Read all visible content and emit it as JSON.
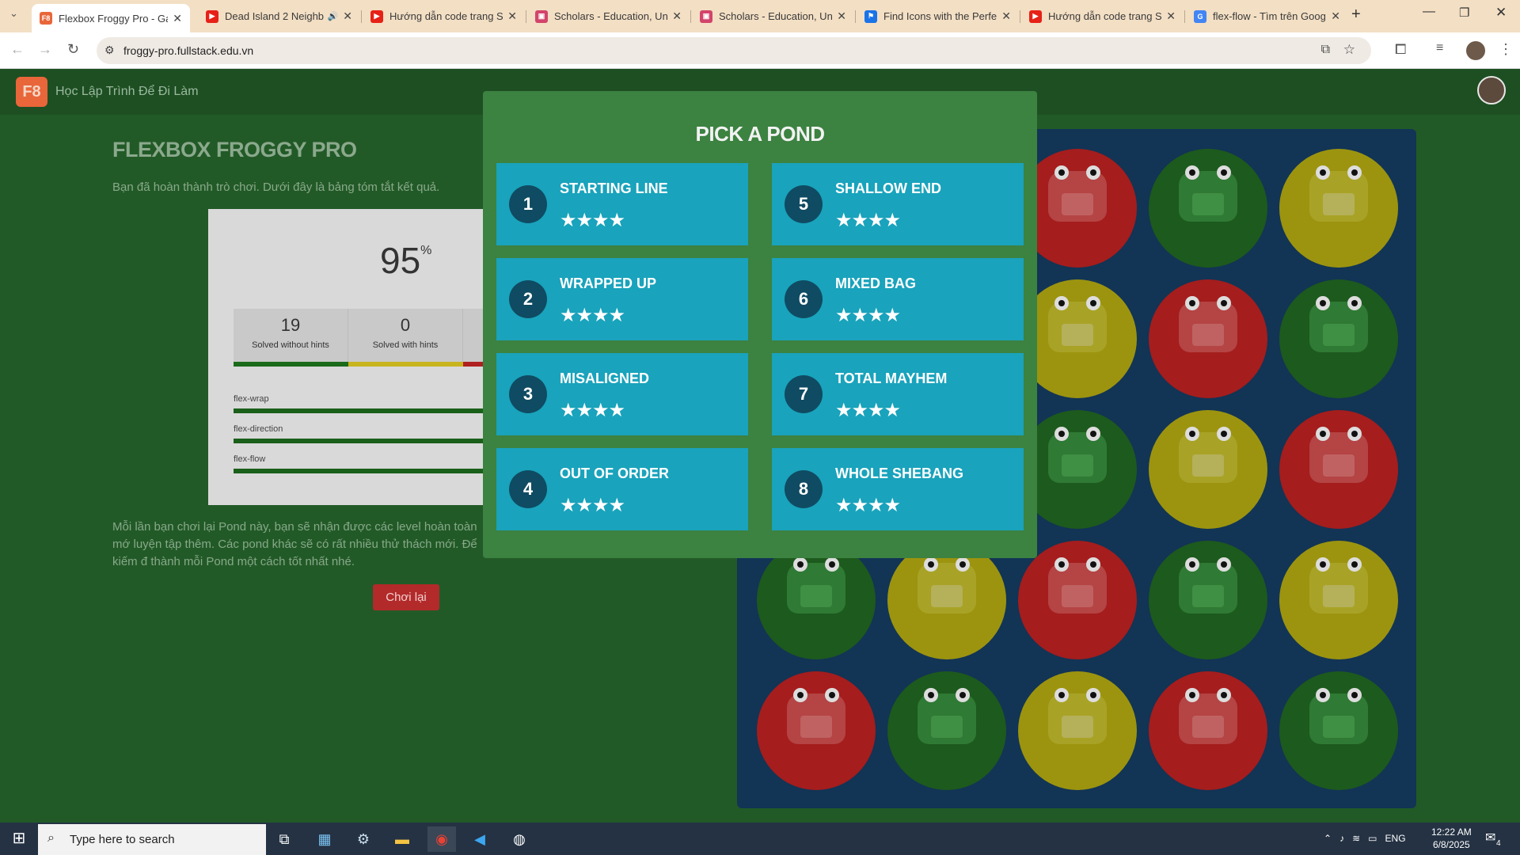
{
  "browser": {
    "tabs": [
      {
        "title": "Flexbox Froggy Pro - Gam",
        "icon": "f8-icon",
        "icon_text": "F8",
        "icon_color": "#e8663a",
        "active": true,
        "audio": false
      },
      {
        "title": "Dead Island 2 Neighb",
        "icon": "youtube-icon",
        "icon_text": "▶",
        "icon_color": "#e62117",
        "active": false,
        "audio": true
      },
      {
        "title": "Hướng dẫn code trang Sc",
        "icon": "youtube-icon",
        "icon_text": "▶",
        "icon_color": "#e62117",
        "active": false,
        "audio": false
      },
      {
        "title": "Scholars - Education, Univ",
        "icon": "scholars-icon",
        "icon_text": "▣",
        "icon_color": "#d2446b",
        "active": false,
        "audio": false
      },
      {
        "title": "Scholars - Education, Univ",
        "icon": "scholars-icon",
        "icon_text": "▣",
        "icon_color": "#d2446b",
        "active": false,
        "audio": false
      },
      {
        "title": "Find Icons with the Perfec",
        "icon": "fontawesome-icon",
        "icon_text": "⚑",
        "icon_color": "#1a73e8",
        "active": false,
        "audio": false
      },
      {
        "title": "Hướng dẫn code trang Sc",
        "icon": "youtube-icon",
        "icon_text": "▶",
        "icon_color": "#e62117",
        "active": false,
        "audio": false
      },
      {
        "title": "flex-flow - Tìm trên Goog",
        "icon": "google-icon",
        "icon_text": "G",
        "icon_color": "#4285f4",
        "active": false,
        "audio": false
      }
    ],
    "url": "froggy-pro.fullstack.edu.vn"
  },
  "site": {
    "logo": "F8",
    "name": "Học Lập Trình Để Đi Làm"
  },
  "results": {
    "title": "FLEXBOX FROGGY PRO",
    "intro": "Bạn đã hoàn thành trò chơi. Dưới đây là bảng tóm tắt kết quả.",
    "score": "95",
    "score_unit": "%",
    "stats": [
      {
        "value": "19",
        "label": "Solved without hints"
      },
      {
        "value": "0",
        "label": "Solved with hints"
      }
    ],
    "properties": [
      "flex-wrap",
      "flex-direction",
      "flex-flow"
    ],
    "bottom_text": "Mỗi lần bạn chơi lại Pond này, bạn sẽ nhận được các level hoàn toàn mớ luyện tập thêm. Các pond khác sẽ có rất nhiều thử thách mới. Để kiếm đ thành mỗi Pond một cách tốt nhất nhé.",
    "replay_label": "Chơi lại"
  },
  "modal": {
    "title": "PICK A POND",
    "ponds": [
      {
        "num": "1",
        "name": "STARTING LINE",
        "stars": "★★★★"
      },
      {
        "num": "2",
        "name": "WRAPPED UP",
        "stars": "★★★★"
      },
      {
        "num": "3",
        "name": "MISALIGNED",
        "stars": "★★★★"
      },
      {
        "num": "4",
        "name": "OUT OF ORDER",
        "stars": "★★★★"
      },
      {
        "num": "5",
        "name": "SHALLOW END",
        "stars": "★★★★"
      },
      {
        "num": "6",
        "name": "MIXED BAG",
        "stars": "★★★★"
      },
      {
        "num": "7",
        "name": "TOTAL MAYHEM",
        "stars": "★★★★"
      },
      {
        "num": "8",
        "name": "WHOLE SHEBANG",
        "stars": "★★★★"
      }
    ]
  },
  "board": {
    "colors": {
      "red": {
        "pad": "#a51d1d",
        "frog": "#b54444",
        "belly": "#c06262"
      },
      "green": {
        "pad": "#1d5a1d",
        "frog": "#2f7a34",
        "belly": "#3f8f45"
      },
      "yellow": {
        "pad": "#9c940f",
        "frog": "#a8a326",
        "belly": "#b5b05a"
      }
    },
    "rows": [
      [
        "red",
        "green",
        "yellow"
      ],
      [
        "yellow",
        "red",
        "green"
      ],
      [
        "green",
        "yellow",
        "red"
      ],
      [
        "green",
        "yellow",
        "red",
        "green",
        "yellow"
      ],
      [
        "red",
        "green",
        "yellow",
        "red",
        "green"
      ]
    ]
  },
  "taskbar": {
    "search_placeholder": "Type here to search",
    "language": "ENG",
    "time": "12:22 AM",
    "date": "6/8/2025",
    "notifications": "4"
  }
}
